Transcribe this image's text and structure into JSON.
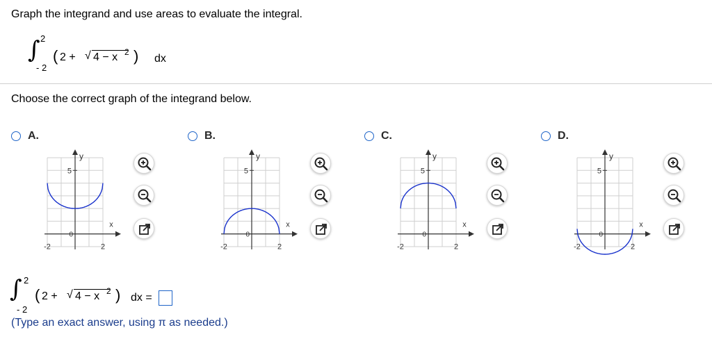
{
  "prompt": "Graph the integrand and use areas to evaluate the integral.",
  "integral": {
    "upper": "2",
    "lower": "- 2",
    "open_paren": "(",
    "constant": "2 +",
    "radical_symbol": "√",
    "radicand_base": "4 − x",
    "exponent": "2",
    "close_paren": ")",
    "dx": "dx"
  },
  "choose_label": "Choose the correct graph of the integrand below.",
  "options": [
    {
      "label": "A.",
      "curve": "bowl-high"
    },
    {
      "label": "B.",
      "curve": "dome-low"
    },
    {
      "label": "C.",
      "curve": "dome-high"
    },
    {
      "label": "D.",
      "curve": "bowl-low"
    }
  ],
  "graph_labels": {
    "y_axis": "y",
    "x_axis": "x",
    "y_tick": "5",
    "x_tick_left": "-2",
    "x_tick_right": "2",
    "origin": "0"
  },
  "answer": {
    "equals": "dx =",
    "value": ""
  },
  "note": "(Type an exact answer, using π as needed.)",
  "colors": {
    "curve": "#1a33cc",
    "radio": "#1e64c8",
    "grid": "#cfcfcf",
    "note": "#1a3c8c"
  },
  "icons": [
    "zoom-in-icon",
    "zoom-out-icon",
    "pop-out-icon"
  ]
}
